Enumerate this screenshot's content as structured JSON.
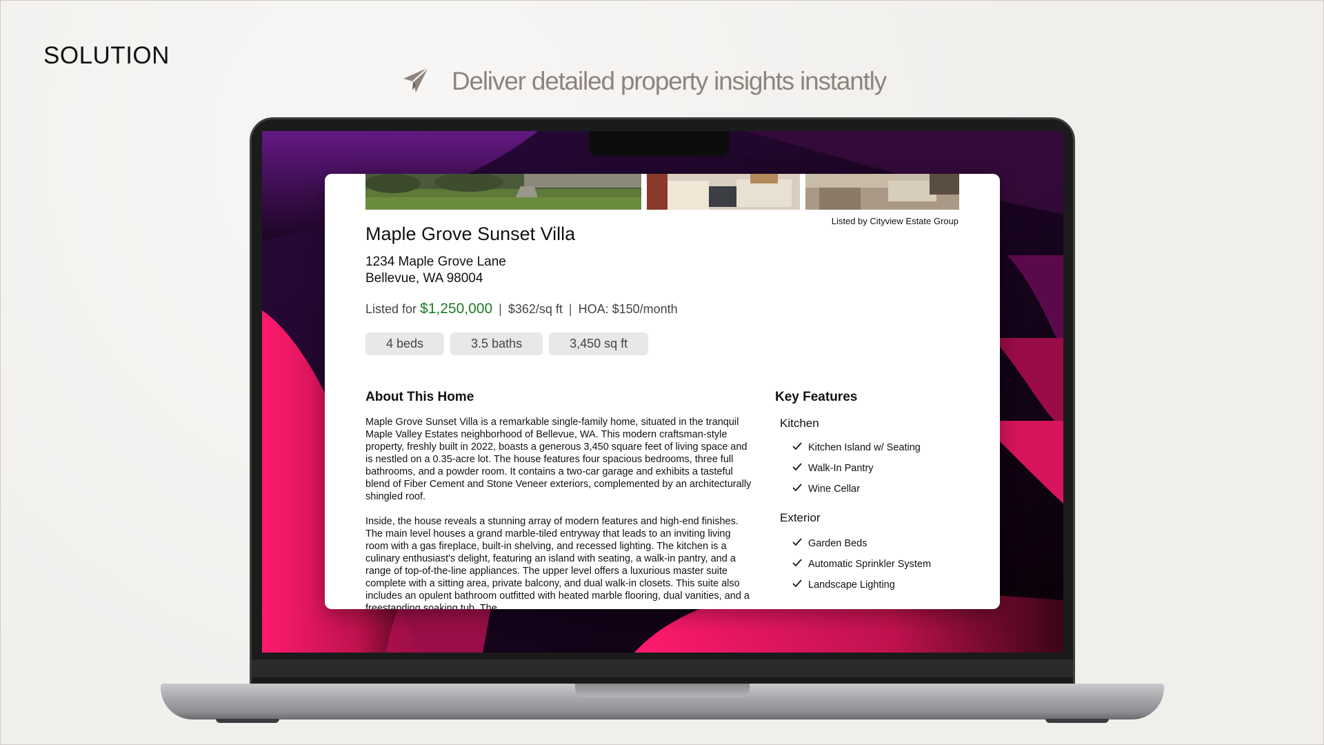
{
  "slide": {
    "label": "SOLUTION",
    "tagline": "Deliver detailed property insights instantly",
    "icon": "paper-plane-icon"
  },
  "colors": {
    "tagline": "#8e847d",
    "price": "#1e7b24",
    "wallpaper_accent": "#ff1a6e"
  },
  "listing": {
    "listed_by": "Listed by Cityview Estate Group",
    "title": "Maple Grove Sunset Villa",
    "address_line1": "1234 Maple Grove Lane",
    "address_line2": "Bellevue, WA 98004",
    "price_prefix": "Listed for",
    "price": "$1,250,000",
    "separator": "|",
    "price_per_sqft": "$362/sq ft",
    "hoa": "HOA: $150/month",
    "chips": [
      "4 beds",
      "3.5 baths",
      "3,450 sq ft"
    ],
    "about": {
      "title": "About This Home",
      "paragraph1": "Maple Grove Sunset Villa is a remarkable single-family home, situated in the tranquil Maple Valley Estates neighborhood of Bellevue, WA. This modern craftsman-style property, freshly built in 2022, boasts a generous 3,450 square feet of living space and is nestled on a 0.35-acre lot. The house features four spacious bedrooms, three full bathrooms, and a powder room. It contains a two-car garage and exhibits a tasteful blend of Fiber Cement and Stone Veneer exteriors, complemented by an architecturally shingled roof.",
      "paragraph2": "Inside, the house reveals a stunning array of modern features and high-end finishes. The main level houses a grand marble-tiled entryway that leads to an inviting living room with a gas fireplace, built-in shelving, and recessed lighting. The kitchen is a culinary enthusiast's delight, featuring an island with seating, a walk-in pantry, and a range of top-of-the-line appliances. The upper level offers a luxurious master suite complete with a sitting area, private balcony, and dual walk-in closets. This suite also includes an opulent bathroom outfitted with heated marble flooring, dual vanities, and a freestanding soaking tub. The"
    },
    "key_features": {
      "title": "Key Features",
      "groups": [
        {
          "name": "Kitchen",
          "items": [
            "Kitchen Island w/ Seating",
            "Walk-In Pantry",
            "Wine Cellar"
          ]
        },
        {
          "name": "Exterior",
          "items": [
            "Garden Beds",
            "Automatic Sprinkler System",
            "Landscape Lighting"
          ]
        }
      ]
    }
  }
}
